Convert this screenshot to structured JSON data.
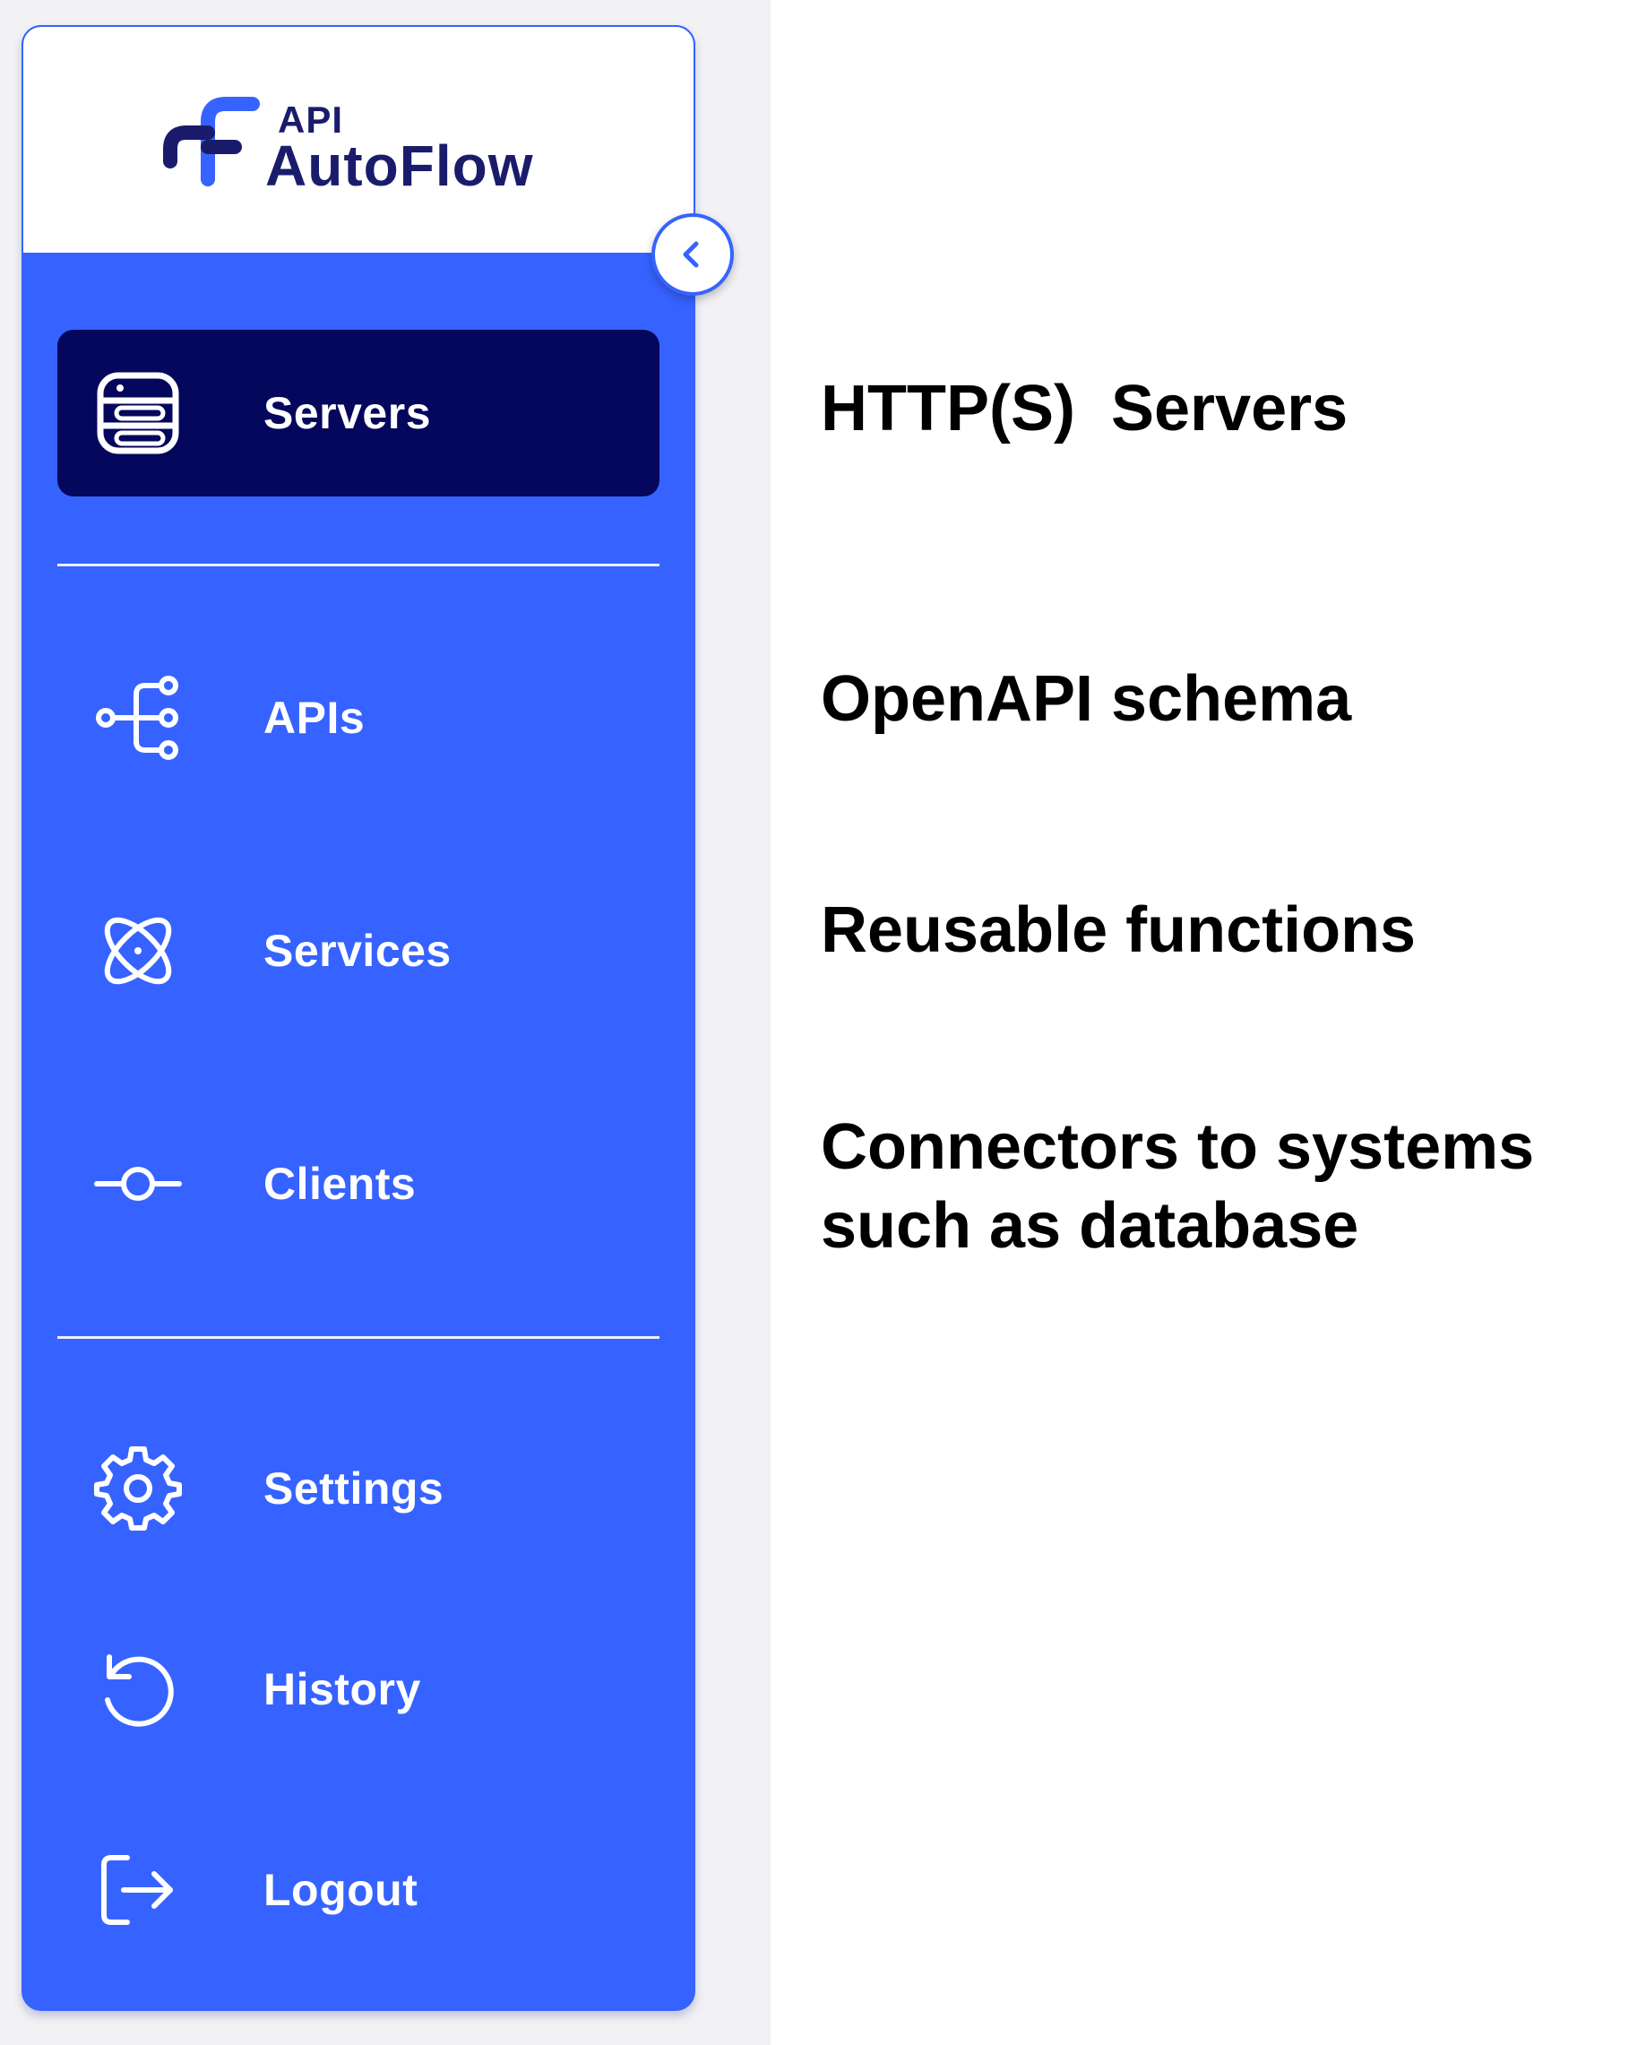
{
  "brand": {
    "logo_small": "API",
    "logo_name": "AutoFlow",
    "color_dark": "#1a1c6b",
    "color_accent": "#3663ff"
  },
  "sidebar": {
    "collapse_icon": "chevron-left-icon",
    "items": [
      {
        "label": "Servers",
        "icon": "server-icon",
        "active": true
      },
      {
        "label": "APIs",
        "icon": "api-branch-icon",
        "active": false
      },
      {
        "label": "Services",
        "icon": "atom-icon",
        "active": false
      },
      {
        "label": "Clients",
        "icon": "commit-node-icon",
        "active": false
      },
      {
        "label": "Settings",
        "icon": "gear-icon",
        "active": false
      },
      {
        "label": "History",
        "icon": "history-icon",
        "active": false
      },
      {
        "label": "Logout",
        "icon": "logout-icon",
        "active": false
      }
    ],
    "active_color": "#04075c",
    "background_color": "#3663ff"
  },
  "descriptions": [
    "HTTP(S)  Servers",
    "OpenAPI schema",
    "Reusable functions",
    "Connectors to systems\nsuch as database"
  ]
}
